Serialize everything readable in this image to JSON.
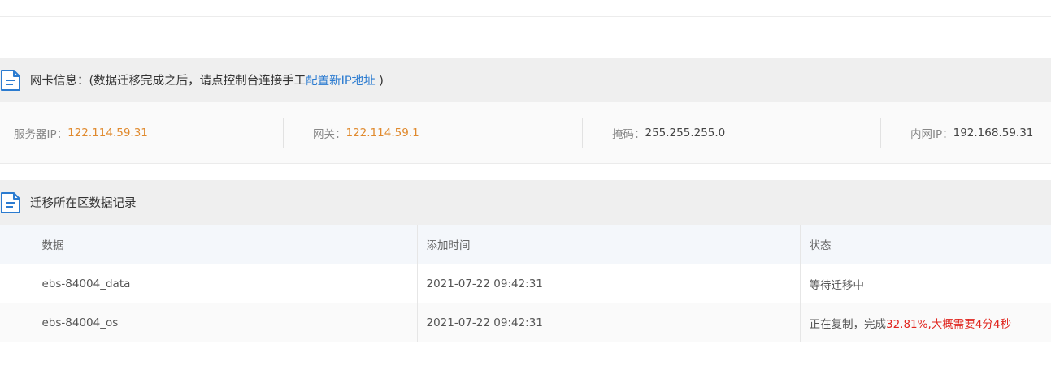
{
  "netcard": {
    "title_prefix": "网卡信息：(数据迁移完成之后，请点控制台连接手工",
    "title_link": "配置新IP地址",
    "title_suffix": " )",
    "fields": [
      {
        "label": "服务器IP：",
        "value": "122.114.59.31"
      },
      {
        "label": "网关：",
        "value": "122.114.59.1"
      },
      {
        "label": "掩码：",
        "value": "255.255.255.0"
      },
      {
        "label": "内网IP：",
        "value": "192.168.59.31"
      }
    ],
    "colors": {
      "highlight": "#e08a2e"
    }
  },
  "records": {
    "title": "迁移所在区数据记录",
    "columns": [
      "数据",
      "添加时间",
      "状态"
    ],
    "rows": [
      {
        "data": "ebs-84004_data",
        "time": "2021-07-22 09:42:31",
        "status": "等待迁移中"
      },
      {
        "data": "ebs-84004_os",
        "time": "2021-07-22 09:42:31",
        "status_prefix": "正在复制，完成",
        "status_percent": "32.81%",
        "status_mid": ",大概需要",
        "status_eta": "4分4秒"
      }
    ]
  },
  "icons": {
    "header": "document-icon"
  },
  "colors": {
    "link": "#2b7bd0",
    "alert": "#e0251e"
  }
}
